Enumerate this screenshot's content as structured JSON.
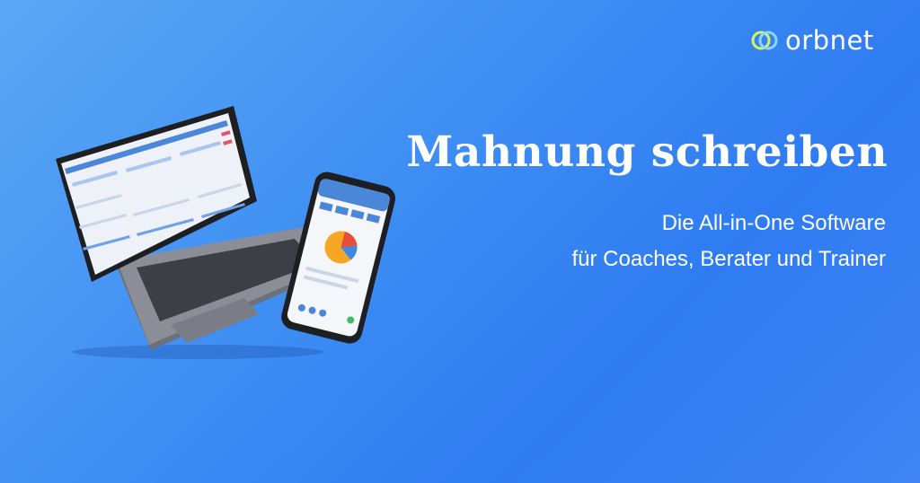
{
  "brand": {
    "name": "orbnet",
    "logo_icon": "orbit-rings-icon"
  },
  "hero": {
    "title": "Mahnung schreiben",
    "subtitle_line1": "Die All-in-One Software",
    "subtitle_line2": "für Coaches, Berater und Trainer"
  },
  "illustration": {
    "devices": [
      "laptop-mockup",
      "smartphone-mockup"
    ]
  },
  "colors": {
    "background": "#3f8ff3",
    "text": "#ffffff",
    "chart_orange": "#f5a623",
    "chart_red": "#e74c3c",
    "chart_blue": "#3b8be0"
  }
}
